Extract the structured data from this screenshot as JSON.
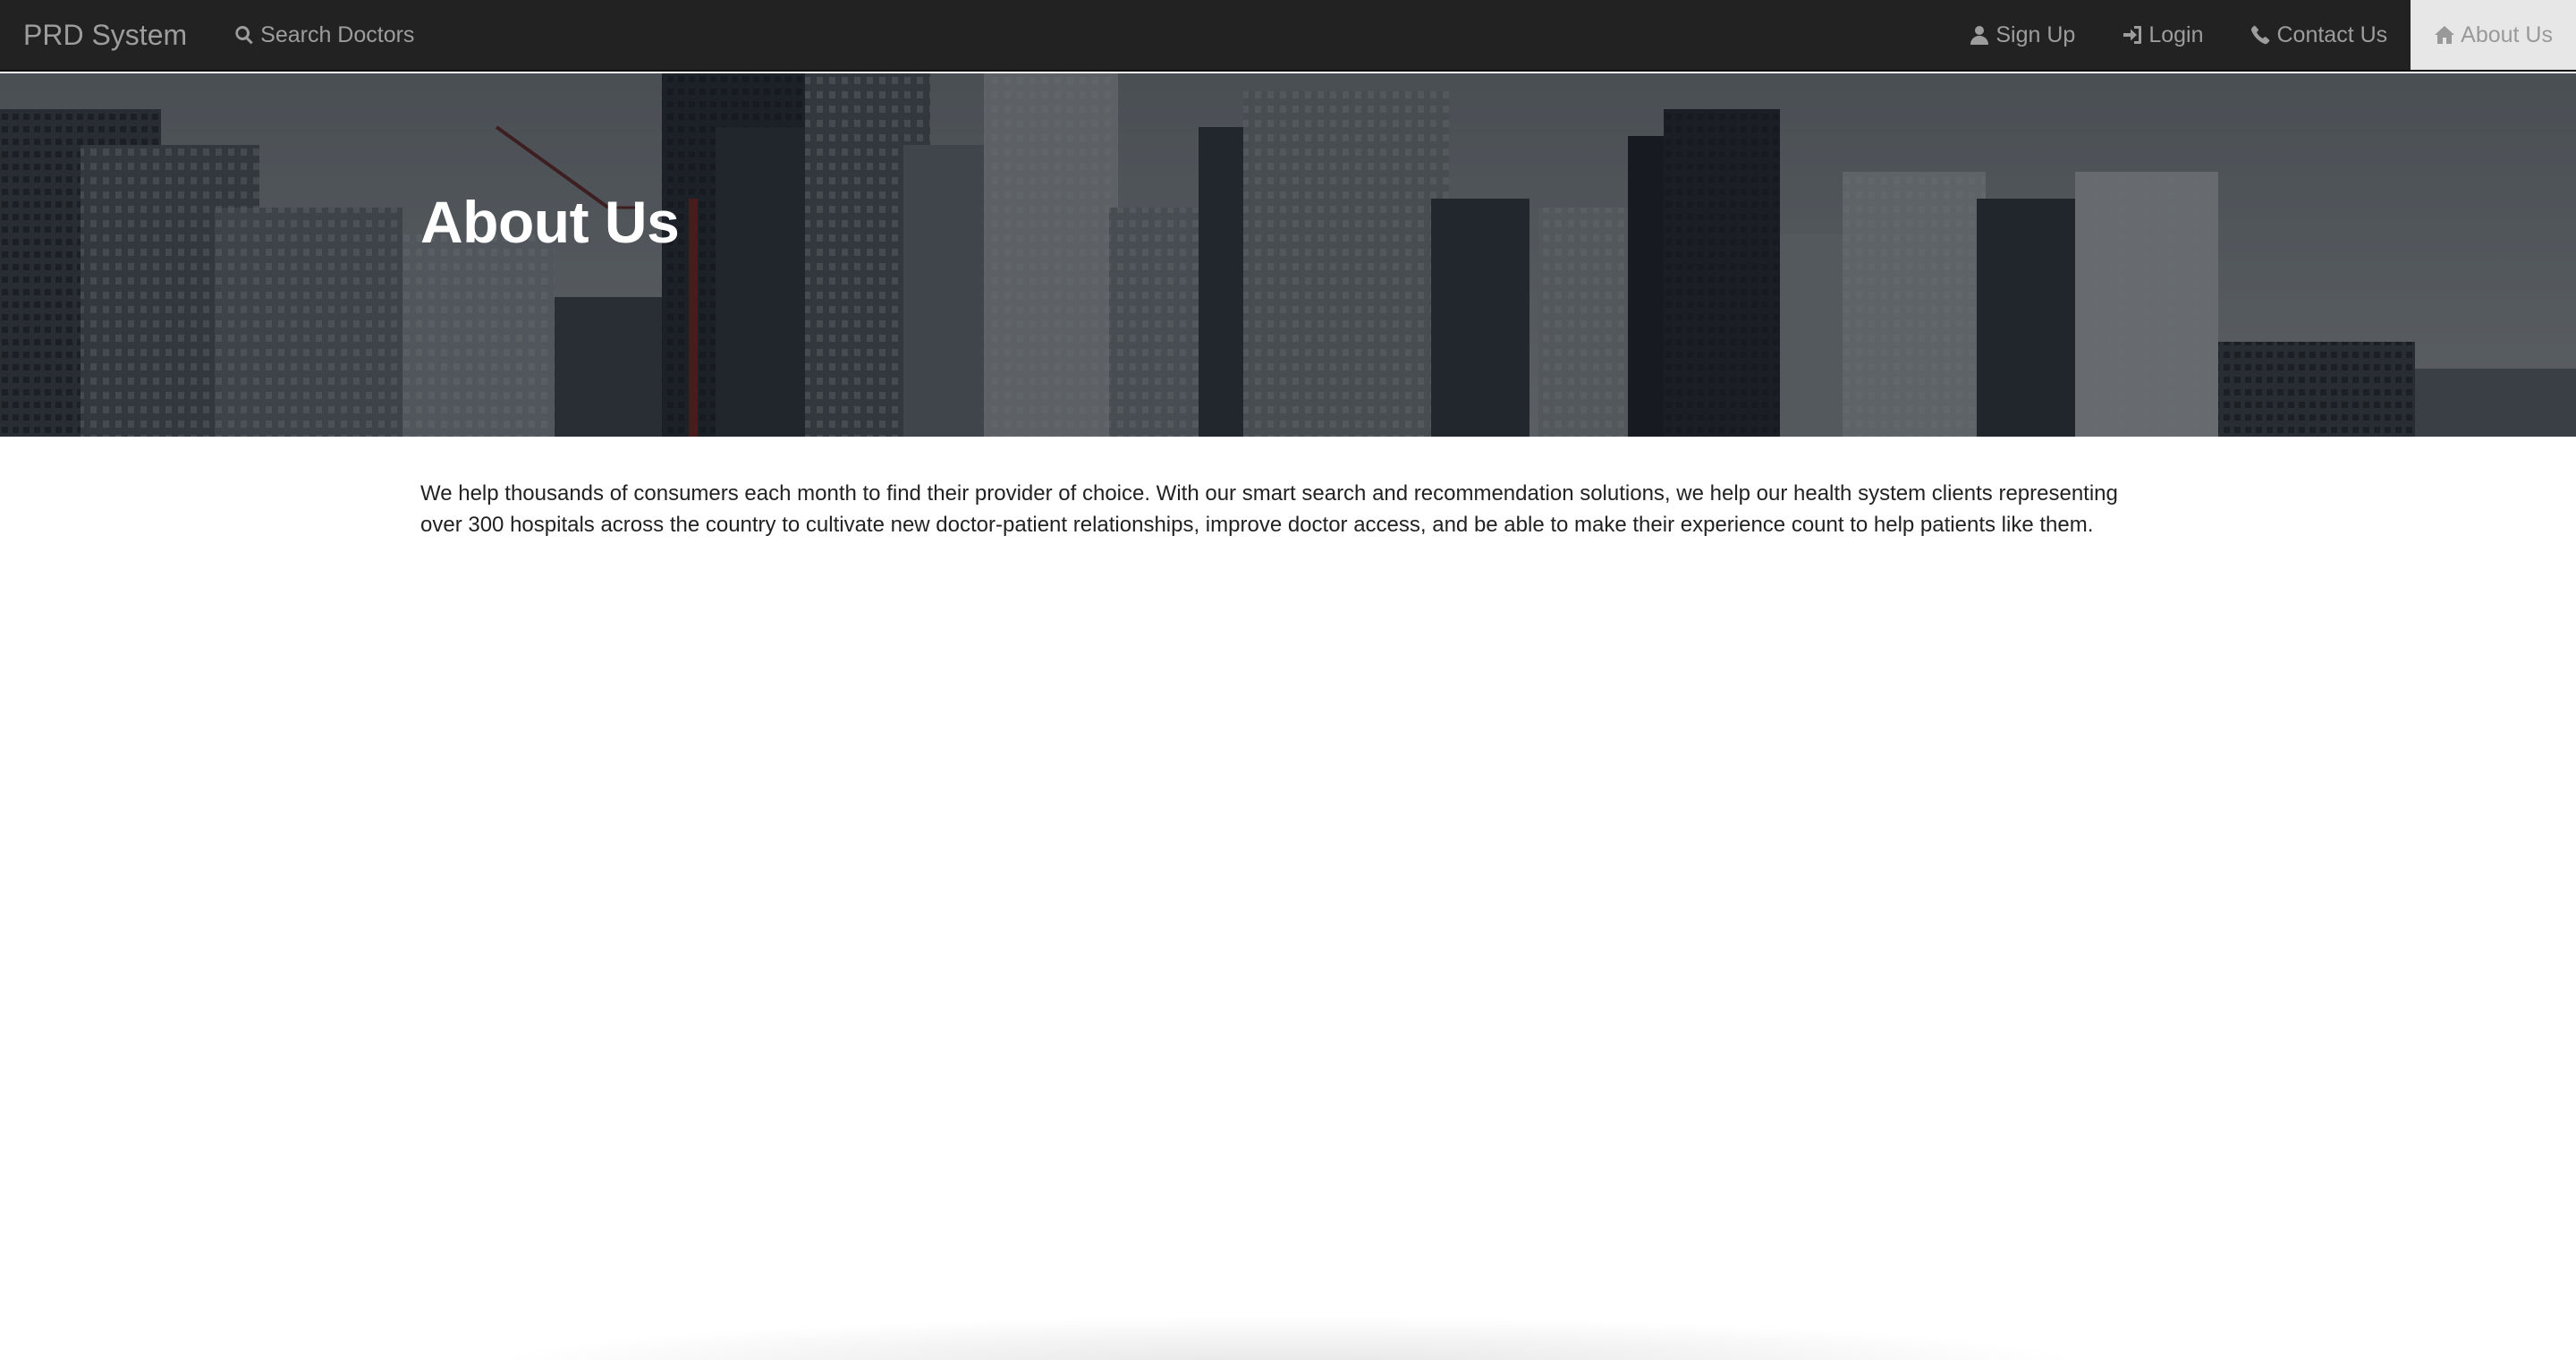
{
  "navbar": {
    "brand": "PRD System",
    "left_items": [
      {
        "label": "Search Doctors",
        "icon": "search-icon"
      }
    ],
    "right_items": [
      {
        "label": "Sign Up",
        "icon": "user-icon"
      },
      {
        "label": "Login",
        "icon": "login-icon"
      },
      {
        "label": "Contact Us",
        "icon": "phone-icon"
      },
      {
        "label": "About Us",
        "icon": "home-icon",
        "active": true
      }
    ]
  },
  "hero": {
    "title": "About Us"
  },
  "main": {
    "paragraph": "We help thousands of consumers each month to find their provider of choice. With our smart search and recommendation solutions, we help our health system clients representing over 300 hospitals across the country to cultivate new doctor-patient relationships, improve doctor access, and be able to make their experience count to help patients like them."
  },
  "colors": {
    "navbar_bg": "#222222",
    "nav_text": "#9d9d9d",
    "active_bg": "#e7e7e7",
    "hero_text": "#ffffff",
    "body_text": "#222222"
  }
}
